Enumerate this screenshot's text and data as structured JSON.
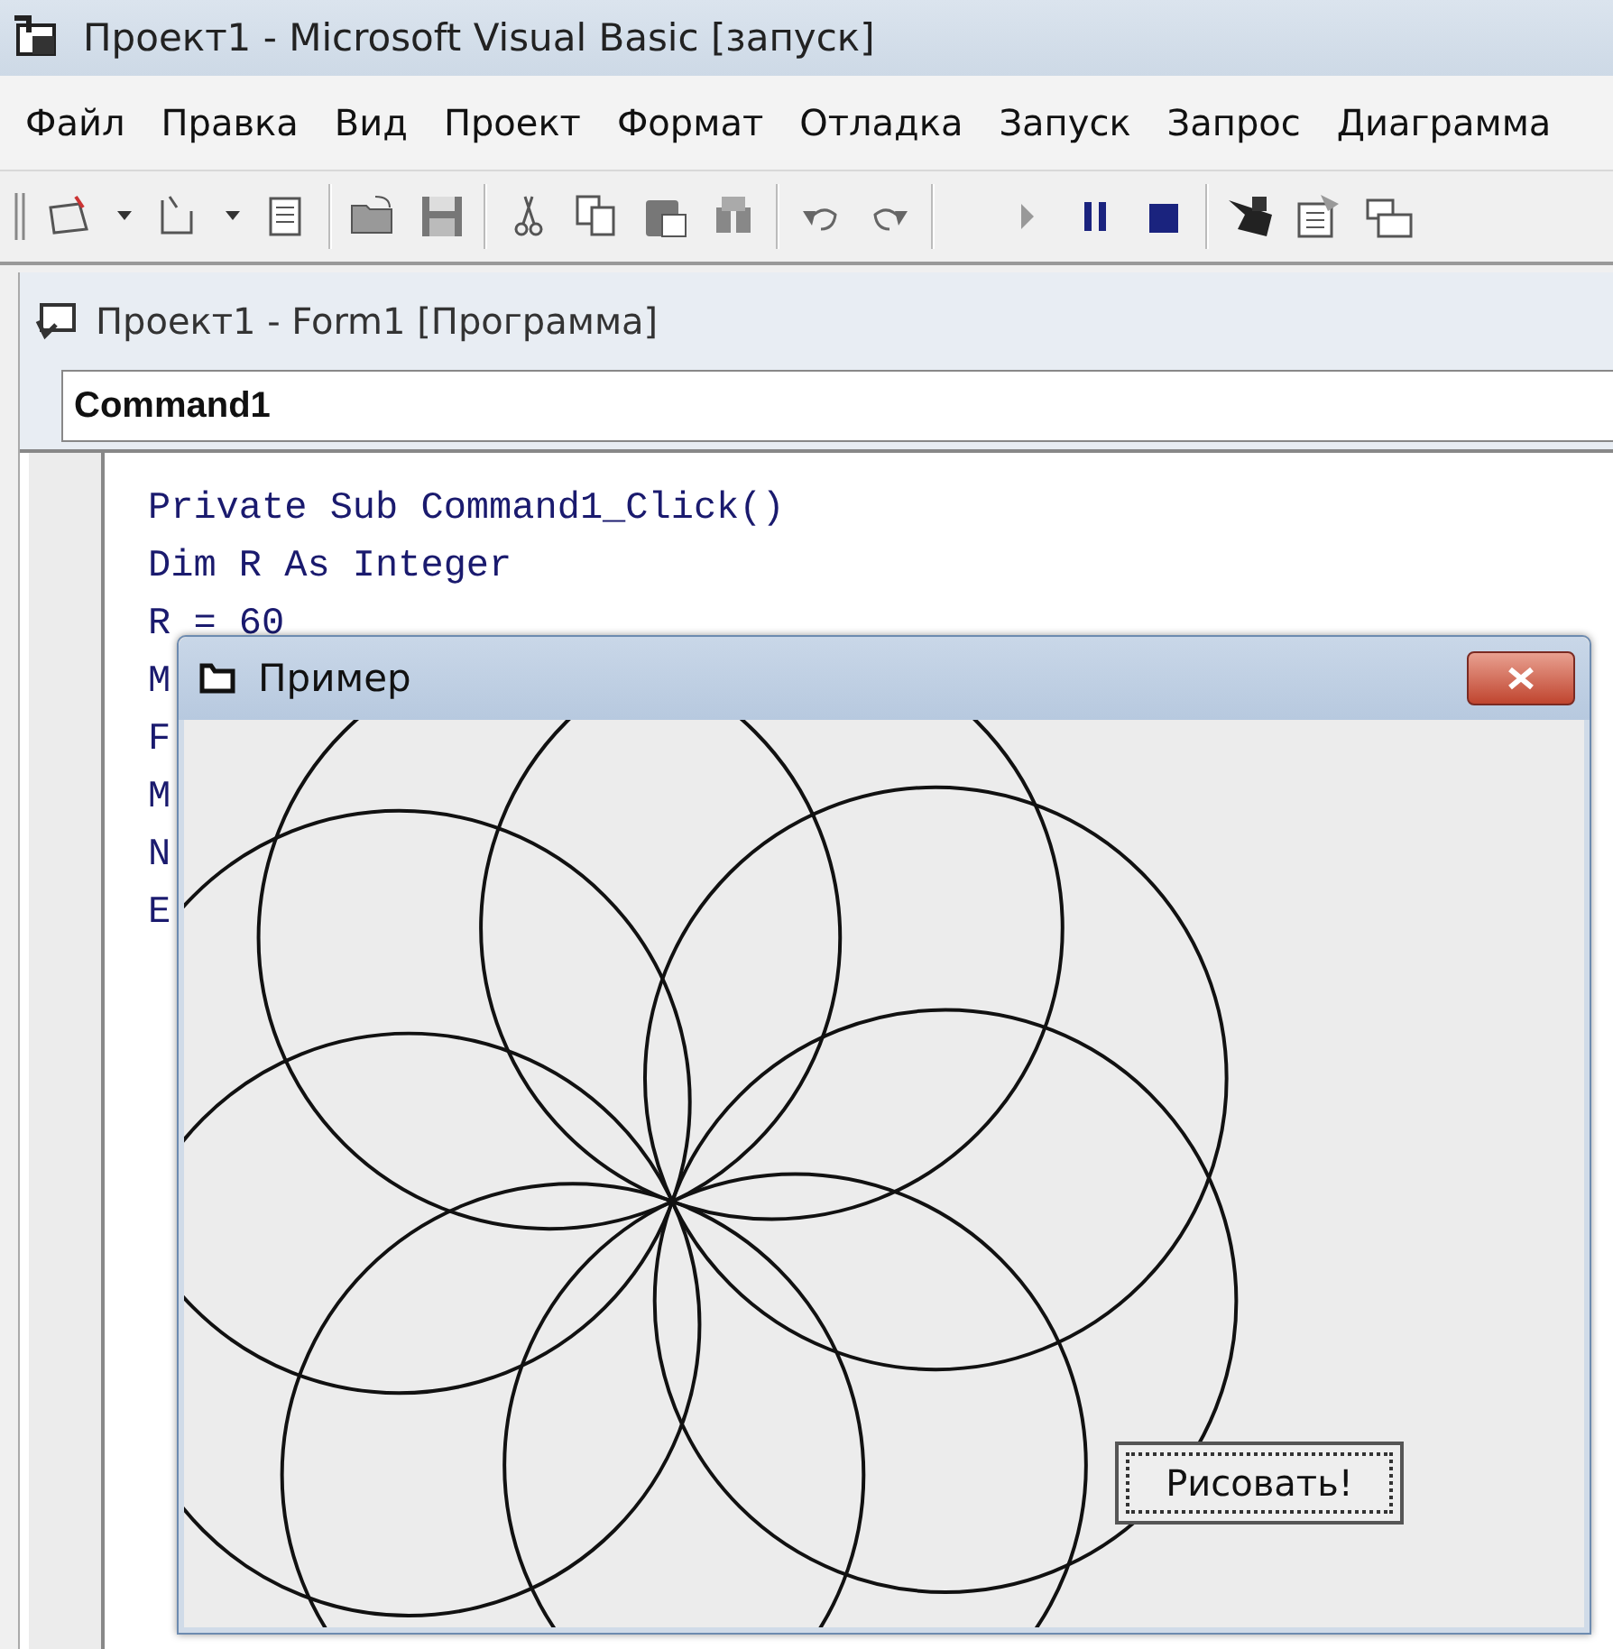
{
  "window": {
    "title": "Проект1 - Microsoft Visual Basic [запуск]"
  },
  "menu": [
    "Файл",
    "Правка",
    "Вид",
    "Проект",
    "Формат",
    "Отладка",
    "Запуск",
    "Запрос",
    "Диаграмма"
  ],
  "code_window": {
    "title": "Проект1 - Form1 [Программа]",
    "object_box": "Command1",
    "lines": [
      "Private Sub Command1_Click()",
      "Dim R As Integer",
      "R = 60",
      "M",
      "F",
      "M",
      "N",
      "E"
    ]
  },
  "form": {
    "title": "Пример",
    "button": "Рисовать!"
  }
}
